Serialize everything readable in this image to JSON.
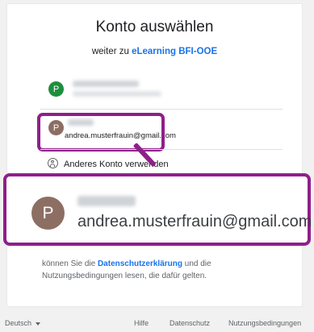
{
  "header": {
    "title": "Konto auswählen",
    "subtitle_prefix": "weiter zu ",
    "subtitle_link": "eLearning BFI-OOE"
  },
  "accounts": [
    {
      "initial": "P",
      "avatar_color": "#1e8e3e"
    },
    {
      "initial": "P",
      "avatar_color": "#8d6e63",
      "email": "andrea.musterfrauin@gmail.com"
    }
  ],
  "use_other_account_label": "Anderes Konto verwenden",
  "zoomed_account": {
    "initial": "P",
    "avatar_color": "#8d6e63",
    "email": "andrea.musterfrauin@gmail.com"
  },
  "terms": {
    "prefix": "können Sie die ",
    "privacy_link": "Datenschutzerklärung",
    "middle": " und die Nutzungsbedingungen lesen, die dafür gelten."
  },
  "footer": {
    "language": "Deutsch",
    "links": [
      "Hilfe",
      "Datenschutz",
      "Nutzungsbedingungen"
    ]
  },
  "colors": {
    "highlight": "#8e1f8a",
    "link": "#1a73e8"
  }
}
